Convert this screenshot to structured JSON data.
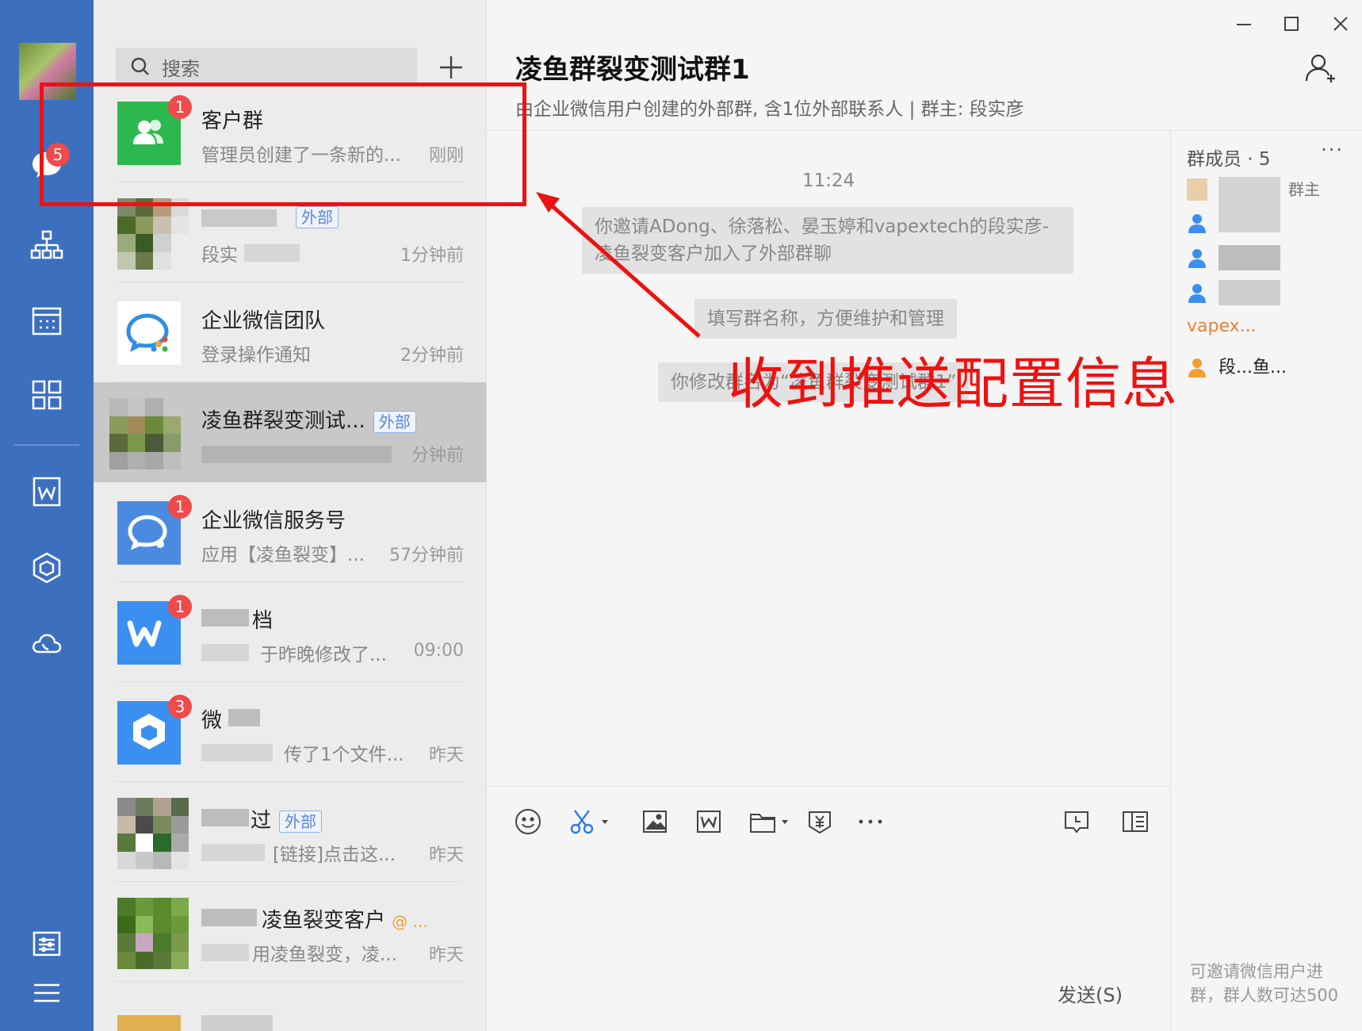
{
  "rail": {
    "unread_badge": "5",
    "nav_items": [
      "avatar",
      "messages-icon",
      "contacts-icon",
      "calendar-icon",
      "workspace-icon",
      "docs-icon",
      "apps-icon",
      "cloud-icon",
      "settings-icon",
      "menu-icon"
    ]
  },
  "search": {
    "placeholder": "搜索"
  },
  "conversations": [
    {
      "name": "客户群",
      "preview": "管理员创建了一条新的...",
      "time": "刚刚",
      "badge": "1"
    },
    {
      "name": "",
      "tag": "外部",
      "preview": "段实",
      "time": "1分钟前"
    },
    {
      "name": "企业微信团队",
      "preview": "登录操作通知",
      "time": "2分钟前"
    },
    {
      "name": "凌鱼群裂变测试...",
      "tag": "外部",
      "preview": "",
      "time": "分钟前"
    },
    {
      "name": "企业微信服务号",
      "preview": "应用【凌鱼裂变】...",
      "time": "57分钟前",
      "badge": "1"
    },
    {
      "name": "档",
      "preview": "于昨晚修改了...",
      "time": "09:00",
      "badge": "1"
    },
    {
      "name": "微",
      "preview": "传了1个文件...",
      "time": "昨天",
      "badge": "3"
    },
    {
      "name": "过",
      "tag": "外部",
      "preview": "[链接]点击这...",
      "time": "昨天"
    },
    {
      "name": "凌鱼裂变客户",
      "at": "@ ...",
      "preview": "用凌鱼裂变，凌...",
      "time": "昨天"
    }
  ],
  "chat": {
    "title": "凌鱼群裂变测试群1",
    "subtitle": "由企业微信用户创建的外部群, 含1位外部联系人 | 群主: 段实彦",
    "timestamp": "11:24",
    "system_messages": [
      "你邀请ADong、徐落松、晏玉婷和vapextech的段实彦-凌鱼裂变客户加入了外部群聊",
      "填写群名称，方便维护和管理",
      "你修改群名为“凌鱼群裂变测试群1”"
    ],
    "send_label": "发送(S)"
  },
  "annotation": {
    "text": "收到推送配置信息",
    "color": "#ee1111"
  },
  "members": {
    "header": "群成员 · 5",
    "owner_label": "群主",
    "external_name": "vapex...",
    "last_member": "段...鱼...",
    "footer": "可邀请微信用户进群，群人数可达500"
  },
  "colors": {
    "rail": "#3d6fbf",
    "badge": "#f04a4a",
    "accent": "#4a8be0",
    "green": "#2cb84e"
  }
}
